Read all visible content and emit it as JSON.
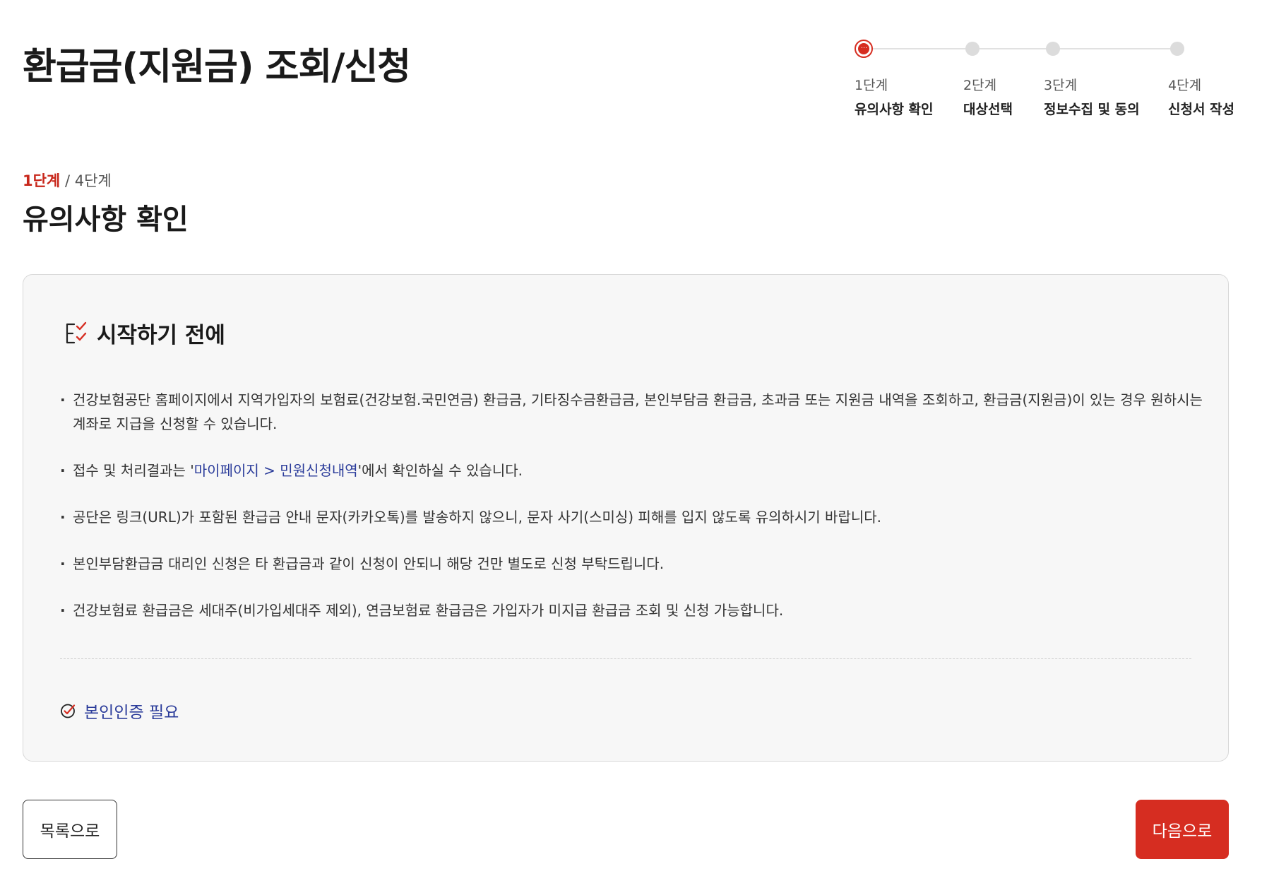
{
  "page": {
    "title": "환급금(지원금) 조회/신청"
  },
  "stepper": {
    "steps": [
      {
        "num": "1단계",
        "label": "유의사항 확인",
        "active": true
      },
      {
        "num": "2단계",
        "label": "대상선택",
        "active": false
      },
      {
        "num": "3단계",
        "label": "정보수집 및 동의",
        "active": false
      },
      {
        "num": "4단계",
        "label": "신청서 작성",
        "active": false
      }
    ],
    "active_icon": "…"
  },
  "step_header": {
    "current": "1단계",
    "separator": " / ",
    "total": "4단계",
    "title": "유의사항 확인"
  },
  "notice": {
    "icon": "checklist-icon",
    "title": "시작하기 전에",
    "items": [
      {
        "text": "건강보험공단 홈페이지에서 지역가입자의 보험료(건강보험.국민연금) 환급금, 기타징수금환급금, 본인부담금 환급금, 초과금 또는 지원금 내역을 조회하고, 환급금(지원금)이 있는 경우 원하시는 계좌로 지급을 신청할 수 있습니다."
      },
      {
        "before": "접수 및 처리결과는 '",
        "link": "마이페이지 > 민원신청내역",
        "after": "'에서 확인하실 수 있습니다."
      },
      {
        "text": "공단은 링크(URL)가 포함된 환급금 안내 문자(카카오톡)를 발송하지 않으니, 문자 사기(스미싱) 피해를 입지 않도록 유의하시기 바랍니다."
      },
      {
        "text": "본인부담환급금 대리인 신청은 타 환급금과 같이 신청이 안되니 해당 건만 별도로 신청 부탁드립니다."
      },
      {
        "text": "건강보험료 환급금은 세대주(비가입세대주 제외), 연금보험료 환급금은 가입자가 미지급 환급금 조회 및 신청 가능합니다."
      }
    ],
    "auth": {
      "icon": "check-circle-icon",
      "label": "본인인증 필요"
    }
  },
  "buttons": {
    "list_label": "목록으로",
    "next_label": "다음으로"
  },
  "colors": {
    "accent": "#d62d21",
    "link": "#2a3b9a",
    "box_bg": "#f7f7f7"
  }
}
